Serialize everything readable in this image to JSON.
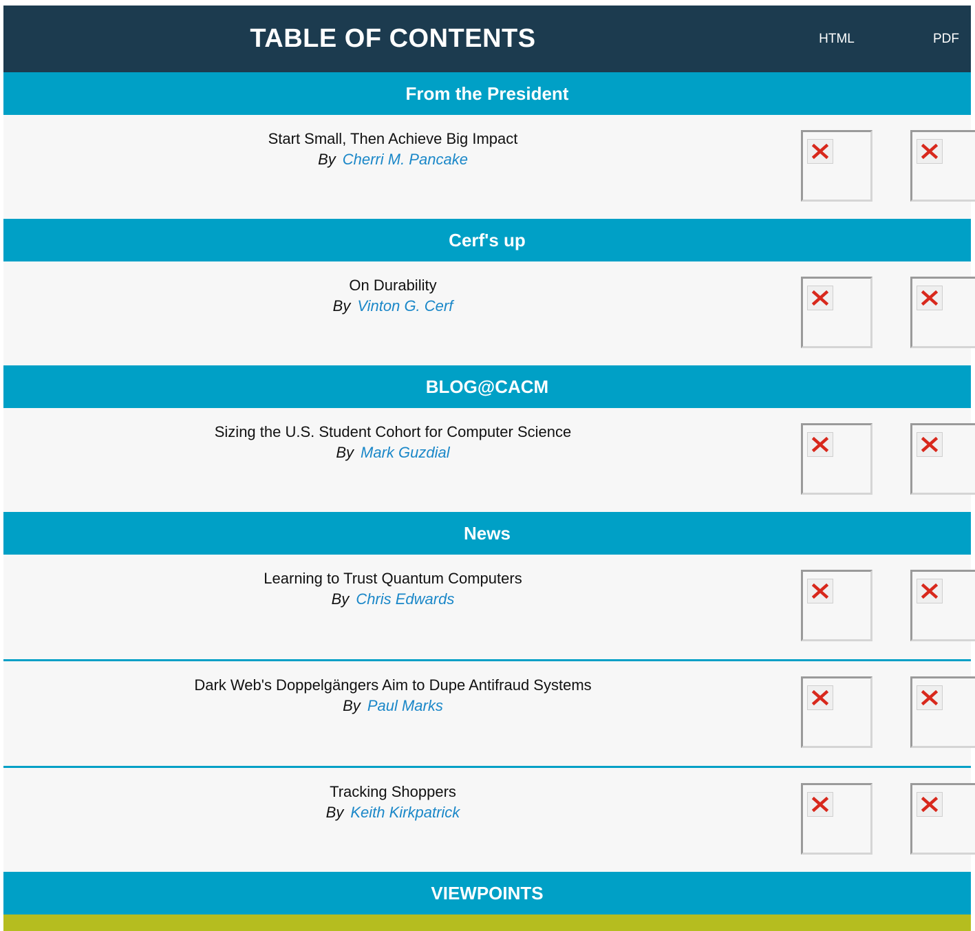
{
  "header": {
    "title": "TABLE OF CONTENTS",
    "col_html": "HTML",
    "col_pdf": "PDF"
  },
  "by_word": "By",
  "sections": [
    {
      "title": "From the President",
      "articles": [
        {
          "title": "Start Small, Then Achieve Big Impact",
          "author": "Cherri M. Pancake"
        }
      ]
    },
    {
      "title": "Cerf's up",
      "articles": [
        {
          "title": "On Durability",
          "author": "Vinton G. Cerf"
        }
      ]
    },
    {
      "title": "BLOG@CACM",
      "articles": [
        {
          "title": "Sizing the U.S. Student Cohort for Computer Science",
          "author": "Mark Guzdial"
        }
      ]
    },
    {
      "title": "News",
      "articles": [
        {
          "title": "Learning to Trust Quantum Computers",
          "author": "Chris Edwards"
        },
        {
          "title": "Dark Web's Doppelgängers Aim to Dupe Antifraud Systems",
          "author": "Paul Marks"
        },
        {
          "title": "Tracking Shoppers",
          "author": "Keith Kirkpatrick"
        }
      ]
    },
    {
      "title": "VIEWPOINTS",
      "articles": []
    }
  ],
  "colors": {
    "header_bg": "#1c3b4f",
    "section_bg": "#00a0c6",
    "author_link": "#1a87c8",
    "bottom_band": "#b5bd1f"
  },
  "icons": {
    "image_placeholder": "broken-image-icon"
  }
}
